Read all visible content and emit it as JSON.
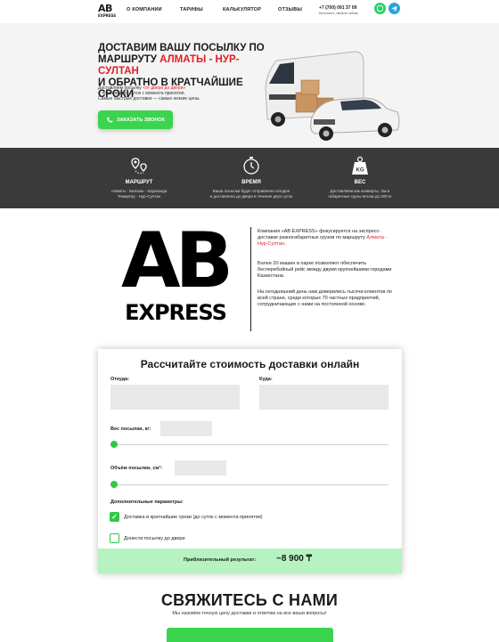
{
  "header": {
    "logo_top": "AB",
    "logo_bottom": "EXPRESS",
    "nav": [
      "О КОМПАНИИ",
      "ТАРИФЫ",
      "КАЛЬКУЛЯТОР",
      "ОТЗЫВЫ"
    ],
    "phone": "+7 (700) 091 37 09",
    "phone_note": "Бесплатно, звоните сейчас"
  },
  "hero": {
    "title_line1": "ДОСТАВИМ ВАШУ ПОСЫЛКУ ПО",
    "title_line2_prefix": "МАРШРУТУ ",
    "title_route": "АЛМАТЫ - НУР-СУЛТАН",
    "title_line3": "И ОБРАТНО В КРАТЧАЙШИЕ СРОКИ",
    "text_prefix": "Доставляем посылку ",
    "text_highlight": "«от двери до двери»",
    "text_rest": "в течение двух суток с момента принятия.",
    "text_line3": "Самые быстрые доставки — самые низкие цены.",
    "cta_label": "ЗАКАЗАТЬ ЗВОНОК"
  },
  "features": [
    {
      "icon": "route-pin-icon",
      "title": "МАРШРУТ",
      "line1": "Алматы - Балхаш - Караганда",
      "line2": "Темиртау - Нур-Султан"
    },
    {
      "icon": "stopwatch-icon",
      "title": "ВРЕМЯ",
      "line1": "Ваша посылка будет отправлена сегодня",
      "line2": "и доставлена до двери в течение двух суток"
    },
    {
      "icon": "weight-kg-icon",
      "title": "ВЕС",
      "line1": "Доставляем как конверты, так и",
      "line2": "габаритные грузы весом до 200 кг"
    }
  ],
  "about": {
    "logo_top": "AB",
    "logo_bottom": "EXPRESS",
    "p1_prefix": "Компания «AB EXPRESS» фокусируется на экспресс-доставке разногабаритных грузов по маршруту ",
    "p1_route": "Алматы - Нур-Султан",
    "p1_suffix": ".",
    "p2": "Более 20 машин в парке позволяют обеспечить бесперебойный рейс между двумя крупнейшими городами Казахстана.",
    "p3": "На сегодняшний день нам доверились тысячи клиентов по всей стране, среди которых 70 частных предприятий, сотрудничающих с нами на постоянной основе."
  },
  "calculator": {
    "title": "Рассчитайте стоимость доставки онлайн",
    "from_label": "Откуда:",
    "to_label": "Куда:",
    "weight_label": "Вес посылки, кг:",
    "volume_label": "Объём посылки, см³:",
    "extra_label": "Дополнительные параметры:",
    "option1": "Доставка в кратчайшие сроки (до суток с момента принятия)",
    "option1_checked": true,
    "option2": "Донести посылку до двери",
    "option2_checked": false,
    "result_label": "Приблизительный результат:",
    "result_value": "~8 900 ₸"
  },
  "contact": {
    "title": "СВЯЖИТЕСЬ С НАМИ",
    "subtitle": "Мы назовём точную цену доставки и ответим на все ваши вопросы!"
  },
  "colors": {
    "accent_green": "#3bd44e",
    "accent_red": "#e31e24",
    "dark_band": "#3a3a3a",
    "result_bg": "#b7f3c0"
  }
}
